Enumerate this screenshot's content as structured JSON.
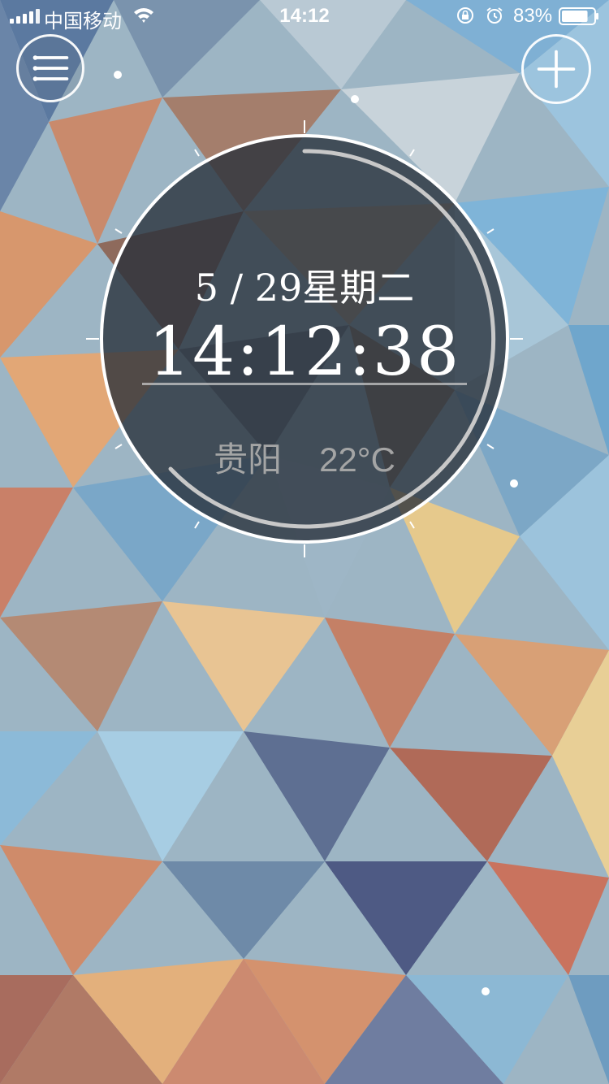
{
  "status_bar": {
    "carrier": "中国移动",
    "time": "14:12",
    "battery_percent": "83%",
    "battery_level": 0.83,
    "icons": [
      "signal-icon",
      "wifi-icon",
      "rotation-lock-icon",
      "alarm-icon",
      "battery-icon"
    ]
  },
  "top_bar": {
    "menu_icon": "menu-icon",
    "add_icon": "plus-icon"
  },
  "clock_face": {
    "date": "5 / 29星期二",
    "time": "14:12:38",
    "city": "贵阳",
    "temperature": "22°C"
  },
  "colors": {
    "dial_fill": "#2f3a44",
    "ring": "#ffffff",
    "progress_arc": "#c8c8c8",
    "weather_text": "#aaaaaa"
  }
}
